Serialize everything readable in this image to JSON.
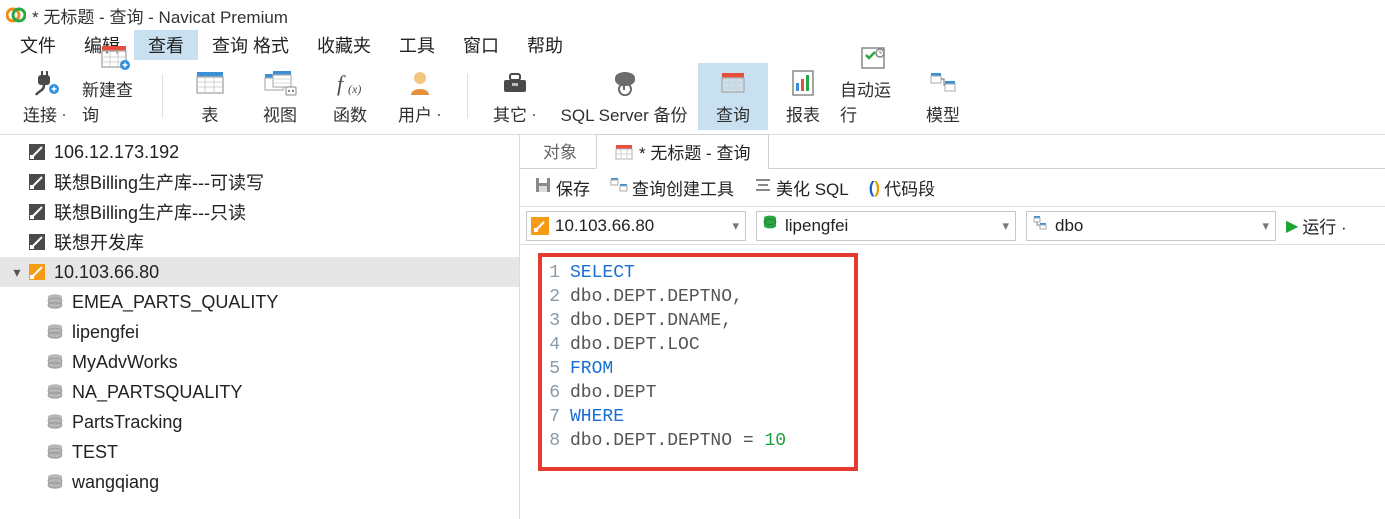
{
  "window": {
    "title": "* 无标题 - 查询 - Navicat Premium"
  },
  "menu": {
    "items": [
      "文件",
      "编辑",
      "查看",
      "查询 格式",
      "收藏夹",
      "工具",
      "窗口",
      "帮助"
    ],
    "selected_index": 2
  },
  "toolbar": {
    "connect": "连接",
    "new_query": "新建查询",
    "table": "表",
    "view": "视图",
    "function": "函数",
    "user": "用户",
    "other": "其它",
    "backup": "SQL Server 备份",
    "query": "查询",
    "report": "报表",
    "autorun": "自动运行",
    "model": "模型",
    "selected": "query"
  },
  "sidebar": {
    "connections": [
      {
        "label": "106.12.173.192"
      },
      {
        "label": "联想Billing生产库---可读写"
      },
      {
        "label": "联想Billing生产库---只读"
      },
      {
        "label": "联想开发库"
      }
    ],
    "active_connection": {
      "label": "10.103.66.80",
      "expanded": true,
      "databases": [
        "EMEA_PARTS_QUALITY",
        "lipengfei",
        "MyAdvWorks",
        "NA_PARTSQUALITY",
        "PartsTracking",
        "TEST",
        "wangqiang"
      ]
    }
  },
  "tabs": {
    "object": "对象",
    "active_title": "* 无标题 - 查询"
  },
  "query_toolbar": {
    "save": "保存",
    "builder": "查询创建工具",
    "beautify": "美化 SQL",
    "snippet": "代码段"
  },
  "selectors": {
    "connection": "10.103.66.80",
    "database": "lipengfei",
    "schema": "dbo",
    "run": "运行 ·"
  },
  "sql": {
    "lines": [
      {
        "n": 1,
        "tokens": [
          {
            "t": "kw",
            "v": "SELECT"
          }
        ]
      },
      {
        "n": 2,
        "tokens": [
          {
            "t": "ident",
            "v": "dbo.DEPT.DEPTNO"
          },
          {
            "t": "op",
            "v": ","
          }
        ]
      },
      {
        "n": 3,
        "tokens": [
          {
            "t": "ident",
            "v": "dbo.DEPT.DNAME"
          },
          {
            "t": "op",
            "v": ","
          }
        ]
      },
      {
        "n": 4,
        "tokens": [
          {
            "t": "ident",
            "v": "dbo.DEPT.LOC"
          }
        ]
      },
      {
        "n": 5,
        "tokens": [
          {
            "t": "kw",
            "v": "FROM"
          }
        ]
      },
      {
        "n": 6,
        "tokens": [
          {
            "t": "ident",
            "v": "dbo.DEPT"
          }
        ]
      },
      {
        "n": 7,
        "tokens": [
          {
            "t": "kw",
            "v": "WHERE"
          }
        ]
      },
      {
        "n": 8,
        "tokens": [
          {
            "t": "ident",
            "v": "dbo.DEPT.DEPTNO"
          },
          {
            "t": "op",
            "v": " = "
          },
          {
            "t": "num",
            "v": "10"
          }
        ]
      }
    ]
  }
}
